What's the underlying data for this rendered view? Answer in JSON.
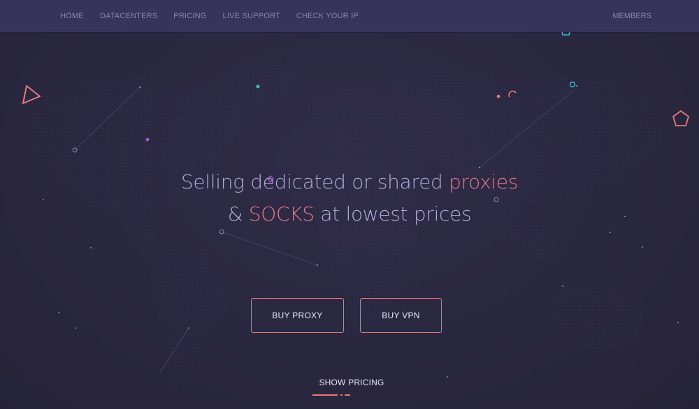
{
  "nav": {
    "items": [
      {
        "label": "HOME"
      },
      {
        "label": "DATACENTERS"
      },
      {
        "label": "PRICING"
      },
      {
        "label": "LIVE SUPPORT"
      },
      {
        "label": "CHECK YOUR IP"
      }
    ],
    "members_label": "MEMBERS"
  },
  "hero": {
    "line1_a": "Selling dedicated or shared ",
    "line1_accent": "proxies",
    "line2_a": "& ",
    "line2_accent": "SOCKS",
    "line2_b": " at lowest prices"
  },
  "buttons": {
    "buy_proxy": "BUY PROXY",
    "buy_vpn": "BUY VPN"
  },
  "show_pricing": "SHOW PRICING",
  "colors": {
    "background": "#2a2740",
    "navbar": "#37335a",
    "text_muted": "#8b86ad",
    "hero_text": "#b1acd7",
    "accent": "#e57a8a",
    "teal": "#3fb9c9",
    "purple": "#9b59d6"
  },
  "icons": [
    "triangle-outline-icon",
    "pentagon-outline-icon",
    "ring-icon",
    "arc-icon",
    "map-pin-icon"
  ]
}
